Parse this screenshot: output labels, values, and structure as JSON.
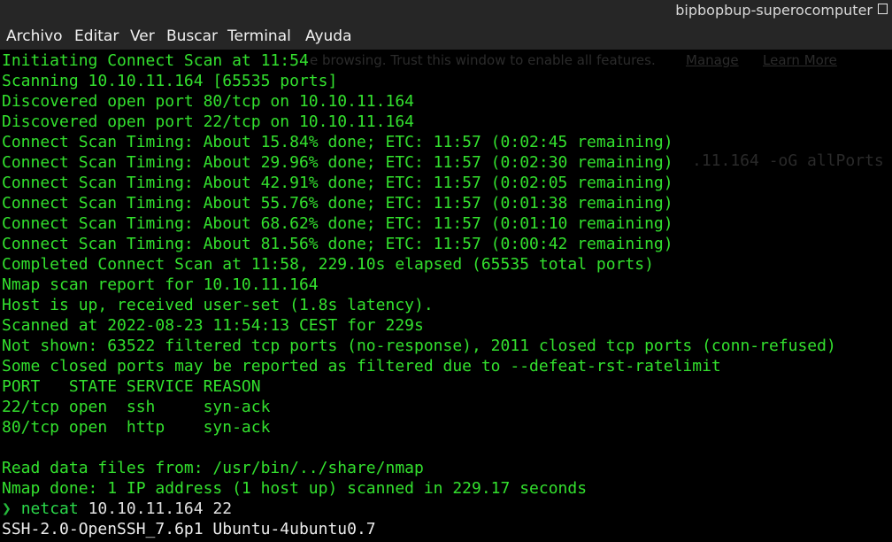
{
  "window": {
    "title": "bipbopbup-superocomputer"
  },
  "menubar": {
    "items": [
      "Archivo",
      "Editar",
      "Ver",
      "Buscar",
      "Terminal",
      "Ayuda"
    ]
  },
  "ghost_overlay": {
    "infobar_text": "e browsing. Trust this window to enable all features.",
    "manage_link": "Manage",
    "learn_more_link": "Learn More",
    "command_fragment": ".11.164 -oG allPorts"
  },
  "terminal": {
    "scan_lines": [
      "Initiating Connect Scan at 11:54",
      "Scanning 10.10.11.164 [65535 ports]",
      "Discovered open port 80/tcp on 10.10.11.164",
      "Discovered open port 22/tcp on 10.10.11.164",
      "Connect Scan Timing: About 15.84% done; ETC: 11:57 (0:02:45 remaining)",
      "Connect Scan Timing: About 29.96% done; ETC: 11:57 (0:02:30 remaining)",
      "Connect Scan Timing: About 42.91% done; ETC: 11:57 (0:02:05 remaining)",
      "Connect Scan Timing: About 55.76% done; ETC: 11:57 (0:01:38 remaining)",
      "Connect Scan Timing: About 68.62% done; ETC: 11:57 (0:01:10 remaining)",
      "Connect Scan Timing: About 81.56% done; ETC: 11:57 (0:00:42 remaining)",
      "Completed Connect Scan at 11:58, 229.10s elapsed (65535 total ports)",
      "Nmap scan report for 10.10.11.164",
      "Host is up, received user-set (1.8s latency).",
      "Scanned at 2022-08-23 11:54:13 CEST for 229s",
      "Not shown: 63522 filtered tcp ports (no-response), 2011 closed tcp ports (conn-refused)",
      "Some closed ports may be reported as filtered due to --defeat-rst-ratelimit",
      "PORT   STATE SERVICE REASON",
      "22/tcp open  ssh     syn-ack",
      "80/tcp open  http    syn-ack",
      "",
      "Read data files from: /usr/bin/../share/nmap",
      "Nmap done: 1 IP address (1 host up) scanned in 229.17 seconds"
    ],
    "prompt": {
      "arrow": "❯",
      "command": "netcat",
      "args": "10.10.11.164 22"
    },
    "banner": "SSH-2.0-OpenSSH_7.6p1 Ubuntu-4ubuntu0.7"
  },
  "colors": {
    "background": "#000000",
    "chrome": "#262626",
    "output_green": "#33e02e",
    "prompt_green": "#25b83a",
    "banner_white": "#ececec"
  }
}
